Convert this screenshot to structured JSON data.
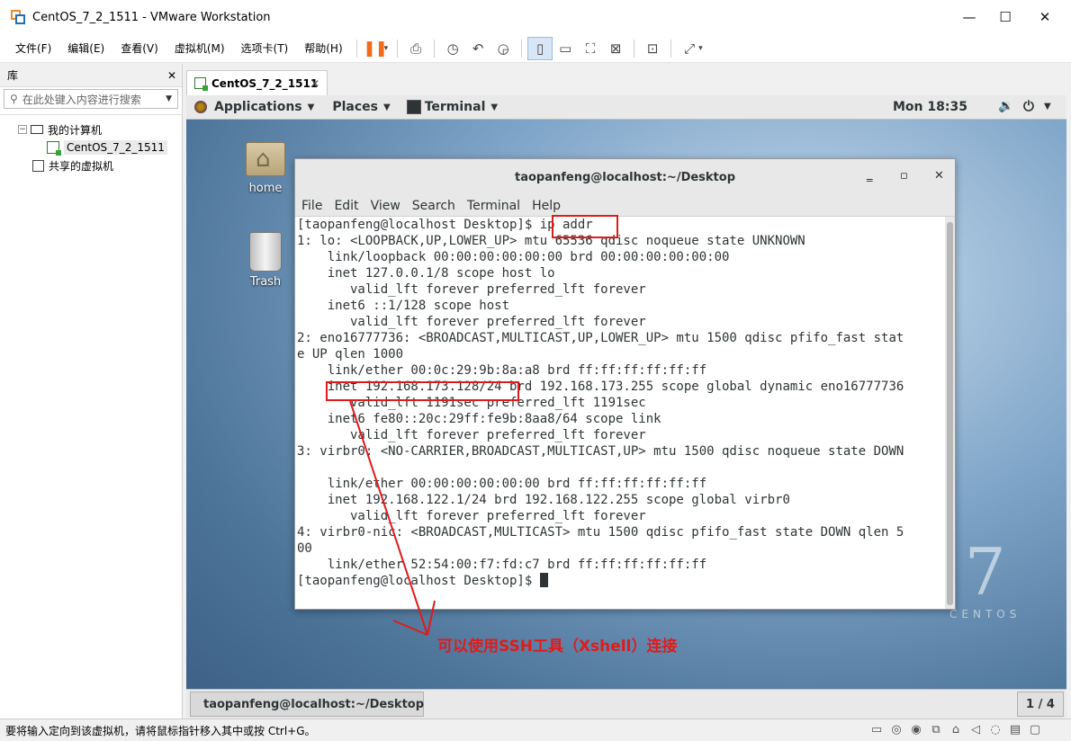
{
  "window": {
    "title": "CentOS_7_2_1511 - VMware Workstation",
    "min_glyph": "—",
    "max_glyph": "☐",
    "close_glyph": "✕"
  },
  "menubar": {
    "items": [
      "文件(F)",
      "编辑(E)",
      "查看(V)",
      "虚拟机(M)",
      "选项卡(T)",
      "帮助(H)"
    ]
  },
  "toolbar": {
    "pause_glyph": "❚❚",
    "caret": "▾",
    "icons": [
      "send-ctrl-alt-del-icon",
      "snapshot-icon",
      "revert-snapshot-icon",
      "snapshot-manager-icon",
      "show-library-icon",
      "thumbnail-icon",
      "full-screen-icon",
      "unity-icon",
      "console-view-icon",
      "stretch-icon"
    ]
  },
  "library": {
    "header": "库",
    "close_glyph": "✕",
    "search_placeholder": "在此处键入内容进行搜索",
    "tree": {
      "my_computer": "我的计算机",
      "vm_name": "CentOS_7_2_1511",
      "shared": "共享的虚拟机"
    }
  },
  "tab": {
    "label": "CentOS_7_2_1511",
    "close_glyph": "✕"
  },
  "guest": {
    "topbar": {
      "applications": "Applications",
      "places": "Places",
      "terminal": "Terminal",
      "clock": "Mon 18:35"
    },
    "desktop_icons": {
      "home": "home",
      "trash": "Trash"
    },
    "brand": {
      "number": "7",
      "word": "CENTOS"
    },
    "terminal": {
      "title": "taopanfeng@localhost:~/Desktop",
      "menu": [
        "File",
        "Edit",
        "View",
        "Search",
        "Terminal",
        "Help"
      ],
      "lines": [
        "[taopanfeng@localhost Desktop]$ ip addr",
        "1: lo: <LOOPBACK,UP,LOWER_UP> mtu 65536 qdisc noqueue state UNKNOWN",
        "    link/loopback 00:00:00:00:00:00 brd 00:00:00:00:00:00",
        "    inet 127.0.0.1/8 scope host lo",
        "       valid_lft forever preferred_lft forever",
        "    inet6 ::1/128 scope host",
        "       valid_lft forever preferred_lft forever",
        "2: eno16777736: <BROADCAST,MULTICAST,UP,LOWER_UP> mtu 1500 qdisc pfifo_fast stat",
        "e UP qlen 1000",
        "    link/ether 00:0c:29:9b:8a:a8 brd ff:ff:ff:ff:ff:ff",
        "    inet 192.168.173.128/24 brd 192.168.173.255 scope global dynamic eno16777736",
        "       valid_lft 1191sec preferred_lft 1191sec",
        "    inet6 fe80::20c:29ff:fe9b:8aa8/64 scope link",
        "       valid_lft forever preferred_lft forever",
        "3: virbr0: <NO-CARRIER,BROADCAST,MULTICAST,UP> mtu 1500 qdisc noqueue state DOWN",
        "",
        "    link/ether 00:00:00:00:00:00 brd ff:ff:ff:ff:ff:ff",
        "    inet 192.168.122.1/24 brd 192.168.122.255 scope global virbr0",
        "       valid_lft forever preferred_lft forever",
        "4: virbr0-nic: <BROADCAST,MULTICAST> mtu 1500 qdisc pfifo_fast state DOWN qlen 5",
        "00",
        "    link/ether 52:54:00:f7:fd:c7 brd ff:ff:ff:ff:ff:ff",
        "[taopanfeng@localhost Desktop]$ "
      ]
    },
    "annotation": "可以使用SSH工具（Xshell）连接",
    "annotation_color": "#e01b1b",
    "taskbar": {
      "task_label": "taopanfeng@localhost:~/Desktop",
      "pager": "1 / 4"
    }
  },
  "statusbar": {
    "text": "要将输入定向到该虚拟机，请将鼠标指针移入其中或按 Ctrl+G。"
  }
}
